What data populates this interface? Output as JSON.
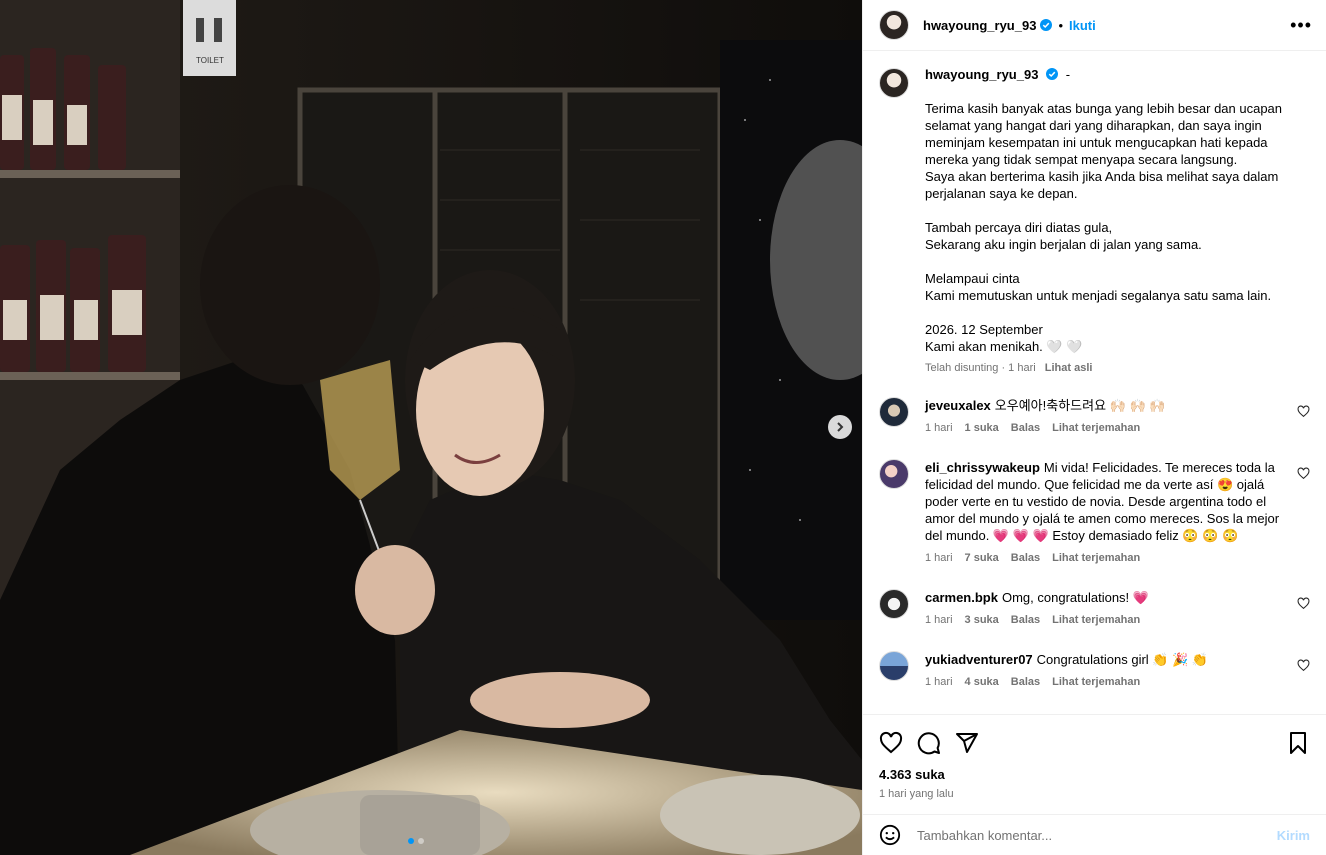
{
  "post": {
    "username": "hwayoung_ryu_93",
    "follow_label": "Ikuti",
    "separator": "•",
    "caption_suffix": "-",
    "caption_text": "Terima kasih banyak atas bunga yang lebih besar dan ucapan selamat yang hangat dari yang diharapkan, dan saya ingin meminjam kesempatan ini untuk mengucapkan hati kepada mereka yang tidak sempat menyapa secara langsung.\nSaya akan berterima kasih jika Anda bisa melihat saya dalam perjalanan saya ke depan.\n\nTambah percaya diri diatas gula,\nSekarang aku ingin berjalan di jalan yang sama.\n\nMelampaui cinta\nKami memutuskan untuk menjadi segalanya satu sama lain.\n\n2026. 12 September\nKami akan menikah. 🤍 🤍",
    "caption_meta": {
      "edited": "Telah disunting",
      "time": "1 hari",
      "see_original": "Lihat asli"
    }
  },
  "comments": [
    {
      "user": "jeveuxalex",
      "text": "오우예아!축하드려요 🙌🏻 🙌🏻 🙌🏻",
      "time": "1 hari",
      "likes": "1 suka",
      "reply": "Balas",
      "translate": "Lihat terjemahan"
    },
    {
      "user": "eli_chrissywakeup",
      "text": "Mi vida! Felicidades. Te mereces toda la felicidad del mundo. Que felicidad me da verte así 😍 ojalá poder verte en tu vestido de novia. Desde argentina todo el amor del mundo y ojalá te amen como mereces. Sos la mejor del mundo. 💗 💗 💗 Estoy demasiado feliz 😳 😳 😳",
      "time": "1 hari",
      "likes": "7 suka",
      "reply": "Balas",
      "translate": "Lihat terjemahan"
    },
    {
      "user": "carmen.bpk",
      "text": "Omg, congratulations! 💗",
      "time": "1 hari",
      "likes": "3 suka",
      "reply": "Balas",
      "translate": "Lihat terjemahan"
    },
    {
      "user": "yukiadventurer07",
      "text": "Congratulations girl 👏 🎉 👏",
      "time": "1 hari",
      "likes": "4 suka",
      "reply": "Balas",
      "translate": "Lihat terjemahan"
    }
  ],
  "footer": {
    "likes": "4.363 suka",
    "ago": "1 hari yang lalu",
    "add_placeholder": "Tambahkan komentar...",
    "send_label": "Kirim"
  },
  "photo": {
    "sign_text": "TOILET"
  }
}
